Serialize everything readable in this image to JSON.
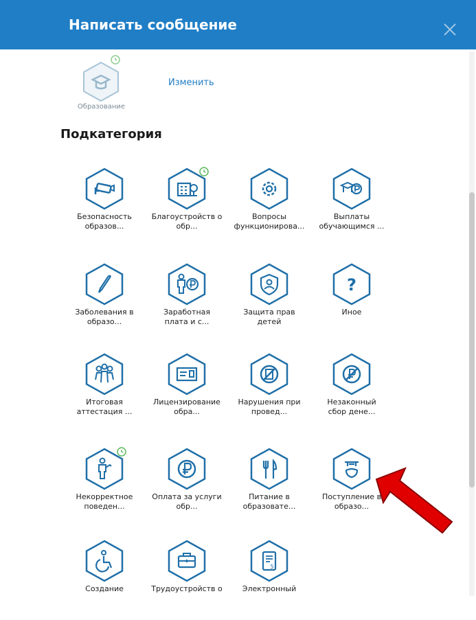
{
  "header": {
    "title": "Написать сообщение"
  },
  "selected": {
    "label": "Образование",
    "change_label": "Изменить"
  },
  "subcategory_title": "Подкатегория",
  "tiles": [
    {
      "line1": "Безопасность",
      "line2": "образов..."
    },
    {
      "line1": "Благоустройств о",
      "line2": "обр..."
    },
    {
      "line1": "Вопросы",
      "line2": "функционирова..."
    },
    {
      "line1": "Выплаты",
      "line2": "обучающимся ..."
    },
    {
      "line1": "Заболевания в",
      "line2": "образо..."
    },
    {
      "line1": "Заработная",
      "line2": "плата и с..."
    },
    {
      "line1": "Защита прав",
      "line2": "детей"
    },
    {
      "line1": "Иное",
      "line2": ""
    },
    {
      "line1": "Итоговая",
      "line2": "аттестация ..."
    },
    {
      "line1": "Лицензирование",
      "line2": "обра..."
    },
    {
      "line1": "Нарушения при",
      "line2": "провед..."
    },
    {
      "line1": "Незаконный",
      "line2": "сбор дене..."
    },
    {
      "line1": "Некорректное",
      "line2": "поведен..."
    },
    {
      "line1": "Оплата за услуги",
      "line2": "обр..."
    },
    {
      "line1": "Питание в",
      "line2": "образовате..."
    },
    {
      "line1": "Поступление в",
      "line2": "образо..."
    },
    {
      "line1": "Создание",
      "line2": ""
    },
    {
      "line1": "Трудоустройств о",
      "line2": ""
    },
    {
      "line1": "Электронный",
      "line2": ""
    }
  ],
  "icons": [
    "camera-icon",
    "building-icon",
    "gear-icon",
    "money-icon",
    "thermometer-icon",
    "salary-icon",
    "shield-person-icon",
    "question-icon",
    "group-icon",
    "certificate-icon",
    "no-document-icon",
    "no-money-icon",
    "person-cane-icon",
    "ruble-icon",
    "cutlery-icon",
    "graduate-icon",
    "wheelchair-icon",
    "briefcase-icon",
    "document-icon"
  ],
  "colors": {
    "header": "#1f7ec6",
    "accent": "#1f7ec6",
    "badge": "#5cb85c",
    "arrow": "#e00000"
  }
}
